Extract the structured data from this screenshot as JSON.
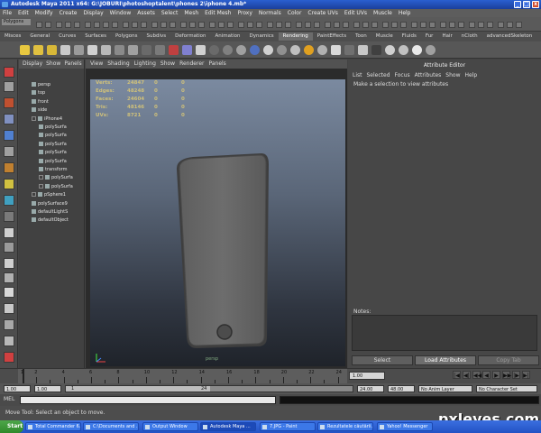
{
  "window": {
    "title": "Autodesk Maya 2011 x64: G:\\JOBURI\\photoshoptalent\\phones 2\\iphone 4.mb*"
  },
  "menubar": [
    "File",
    "Edit",
    "Modify",
    "Create",
    "Display",
    "Window",
    "Assets",
    "Select",
    "Mesh",
    "Edit Mesh",
    "Proxy",
    "Normals",
    "Color",
    "Create UVs",
    "Edit UVs",
    "Muscle",
    "Help"
  ],
  "mode_selector": "Polygons",
  "shelf_tabs": [
    {
      "label": "Misces",
      "active": false
    },
    {
      "label": "General",
      "active": false
    },
    {
      "label": "Curves",
      "active": false
    },
    {
      "label": "Surfaces",
      "active": false
    },
    {
      "label": "Polygons",
      "active": false
    },
    {
      "label": "Subdivs",
      "active": false
    },
    {
      "label": "Deformation",
      "active": false
    },
    {
      "label": "Animation",
      "active": false
    },
    {
      "label": "Dynamics",
      "active": false
    },
    {
      "label": "Rendering",
      "active": true
    },
    {
      "label": "PaintEffects",
      "active": false
    },
    {
      "label": "Toon",
      "active": false
    },
    {
      "label": "Muscle",
      "active": false
    },
    {
      "label": "Fluids",
      "active": false
    },
    {
      "label": "Fur",
      "active": false
    },
    {
      "label": "Hair",
      "active": false
    },
    {
      "label": "nCloth",
      "active": false
    },
    {
      "label": "advancedSkeleton",
      "active": false
    }
  ],
  "outliner": {
    "menu": [
      "Display",
      "Show",
      "Panels"
    ],
    "items": [
      {
        "label": "persp",
        "indent": 1,
        "expand": false
      },
      {
        "label": "top",
        "indent": 1,
        "expand": false
      },
      {
        "label": "front",
        "indent": 1,
        "expand": false
      },
      {
        "label": "side",
        "indent": 1,
        "expand": false
      },
      {
        "label": "iPhone4",
        "indent": 1,
        "expand": true
      },
      {
        "label": "polySurfa",
        "indent": 2,
        "expand": false
      },
      {
        "label": "polySurfa",
        "indent": 2,
        "expand": false
      },
      {
        "label": "polySurfa",
        "indent": 2,
        "expand": false
      },
      {
        "label": "polySurfa",
        "indent": 2,
        "expand": false
      },
      {
        "label": "polySurfa",
        "indent": 2,
        "expand": false
      },
      {
        "label": "transform",
        "indent": 2,
        "expand": false
      },
      {
        "label": "polySurfa",
        "indent": 2,
        "expand": true
      },
      {
        "label": "polySurfa",
        "indent": 2,
        "expand": true
      },
      {
        "label": "pSphere1",
        "indent": 1,
        "expand": true
      },
      {
        "label": "polySurface9",
        "indent": 1,
        "expand": false
      },
      {
        "label": "defaultLightS",
        "indent": 1,
        "expand": false
      },
      {
        "label": "defaultObject",
        "indent": 1,
        "expand": false
      }
    ]
  },
  "viewport": {
    "menu": [
      "View",
      "Shading",
      "Lighting",
      "Show",
      "Renderer",
      "Panels"
    ],
    "hud": [
      {
        "label": "Verts:",
        "v1": "24847",
        "v2": "0",
        "v3": "0"
      },
      {
        "label": "Edges:",
        "v1": "48248",
        "v2": "0",
        "v3": "0"
      },
      {
        "label": "Faces:",
        "v1": "24604",
        "v2": "0",
        "v3": "0"
      },
      {
        "label": "Tris:",
        "v1": "48146",
        "v2": "0",
        "v3": "0"
      },
      {
        "label": "UVs:",
        "v1": "8721",
        "v2": "0",
        "v3": "0"
      }
    ],
    "camera_label": "persp"
  },
  "attribute_editor": {
    "title": "Attribute Editor",
    "menu": [
      "List",
      "Selected",
      "Focus",
      "Attributes",
      "Show",
      "Help"
    ],
    "message": "Make a selection to view attributes",
    "notes_label": "Notes:",
    "buttons": {
      "select": "Select",
      "load": "Load Attributes",
      "copy": "Copy Tab"
    }
  },
  "timeline": {
    "labels": [
      "1",
      "2",
      "4",
      "6",
      "8",
      "10",
      "12",
      "14",
      "16",
      "18",
      "20",
      "22",
      "24"
    ],
    "current_frame": "1.00",
    "playback_symbols": [
      "|◀",
      "◀|",
      "◀◀",
      "◀",
      "▶",
      "▶▶",
      "|▶",
      "▶|"
    ]
  },
  "range_slider": {
    "start": "1.00",
    "inner_start": "1.00",
    "marker": "1",
    "range_end_marker": "24",
    "end": "24.00",
    "anim_end": "48.00",
    "anim_layer": "No Anim Layer",
    "character_set": "No Character Set"
  },
  "command_line": {
    "label": "MEL"
  },
  "help_line": "Move Tool: Select an object to move.",
  "taskbar": {
    "start": "Start",
    "items": [
      {
        "label": "Total Commander 6...",
        "active": false
      },
      {
        "label": "C:\\Documents and ...",
        "active": false
      },
      {
        "label": "Output Window",
        "active": false
      },
      {
        "label": "Autodesk Maya ...",
        "active": true
      },
      {
        "label": "7.JPG - Paint",
        "active": false
      },
      {
        "label": "Rezultatele căutării...",
        "active": false
      },
      {
        "label": "Yahoo! Messenger",
        "active": false
      }
    ]
  },
  "watermark": "pxleyes.com",
  "colors": {
    "titlebar": "#2a5fd0",
    "hud": "#cfc07a",
    "viewport_top": "#7b8aa0",
    "viewport_bottom": "#1f232a",
    "active_tab": "#6b6b6b"
  }
}
